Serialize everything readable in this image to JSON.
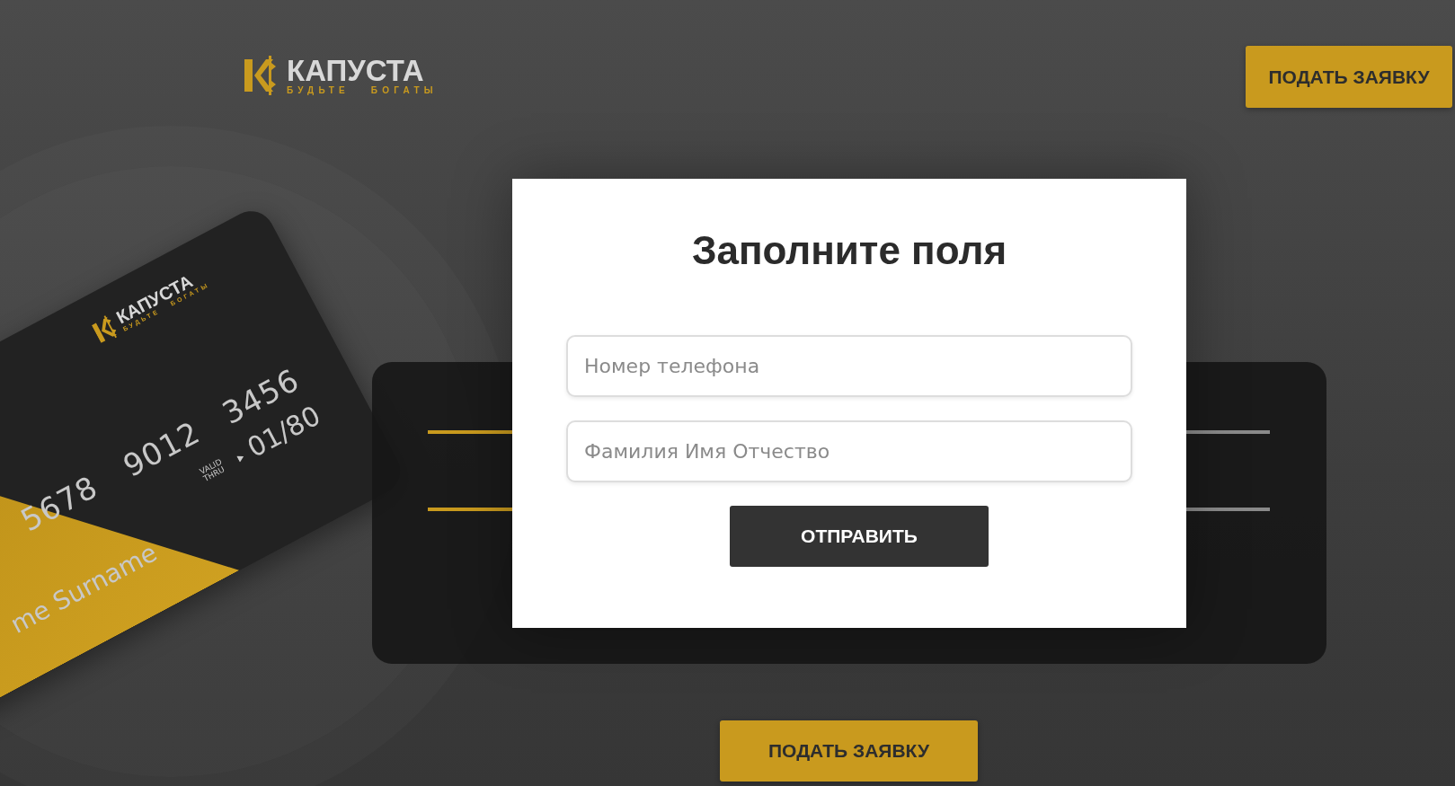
{
  "header": {
    "logo": {
      "name": "КАПУСТА",
      "tagline": "БУДЬТЕ БОГАТЫ"
    },
    "apply_button": "ПОДАТЬ ЗАЯВКУ"
  },
  "card": {
    "logo": {
      "name": "КАПУСТА",
      "tagline": "БУДЬТЕ БОГАТЫ"
    },
    "number_parts": [
      "5678",
      "9012",
      "3456"
    ],
    "valid_thru": "VALID THRU",
    "expiry": "01/80",
    "holder": "me Surname"
  },
  "modal": {
    "title": "Заполните поля",
    "fields": [
      {
        "placeholder": "Номер телефона"
      },
      {
        "placeholder": "Фамилия Имя Отчество"
      }
    ],
    "submit_button": "ОТПРАВИТЬ"
  },
  "bottom_button": "ПОДАТЬ ЗАЯВКУ"
}
